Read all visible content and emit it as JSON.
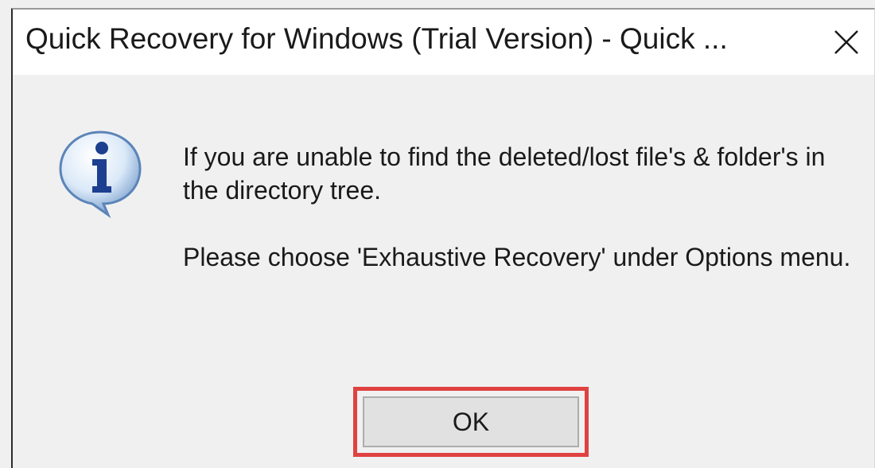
{
  "dialog": {
    "title": "Quick Recovery for Windows (Trial Version) - Quick ...",
    "close_icon": "close-icon",
    "icon": "information-icon",
    "message_line1": "If you are unable to find the deleted/lost file's & folder's in the directory tree.",
    "message_line2": "Please choose 'Exhaustive Recovery' under Options menu.",
    "ok_label": "OK",
    "highlight_color": "#e04141"
  }
}
